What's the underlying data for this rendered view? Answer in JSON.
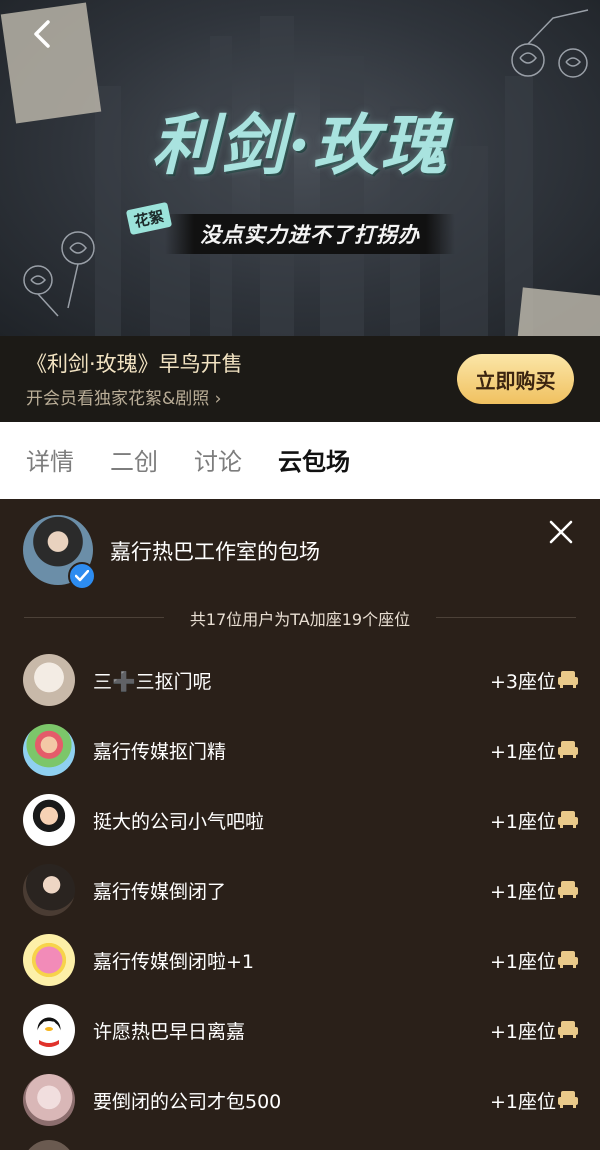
{
  "banner": {
    "title_art": "利剑·玫瑰",
    "tag": "花絮",
    "slogan": "没点实力进不了打拐办"
  },
  "promo": {
    "title": "《利剑·玫瑰》早鸟开售",
    "subtitle": "开会员看独家花絮&剧照 ›",
    "buy_label": "立即购买"
  },
  "tabs": [
    {
      "label": "详情",
      "active": false
    },
    {
      "label": "二创",
      "active": false
    },
    {
      "label": "讨论",
      "active": false
    },
    {
      "label": "云包场",
      "active": true
    }
  ],
  "panel": {
    "host_name": "嘉行热巴工作室的包场",
    "summary": "共17位用户为TA加座19个座位",
    "rows": [
      {
        "name": "三➕三抠门呢",
        "seats": "+3座位"
      },
      {
        "name": "嘉行传媒抠门精",
        "seats": "+1座位"
      },
      {
        "name": "挺大的公司小气吧啦",
        "seats": "+1座位"
      },
      {
        "name": "嘉行传媒倒闭了",
        "seats": "+1座位"
      },
      {
        "name": "嘉行传媒倒闭啦+1",
        "seats": "+1座位"
      },
      {
        "name": "许愿热巴早日离嘉",
        "seats": "+1座位"
      },
      {
        "name": "要倒闭的公司才包500",
        "seats": "+1座位"
      }
    ]
  },
  "colors": {
    "panel_bg": "#2a2019",
    "seat_icon": "#e9c98a",
    "buy_button": "#f0c160",
    "verified": "#2d8cf0"
  },
  "icons": [
    "back-arrow-icon",
    "close-icon",
    "seat-icon",
    "verified-icon"
  ]
}
